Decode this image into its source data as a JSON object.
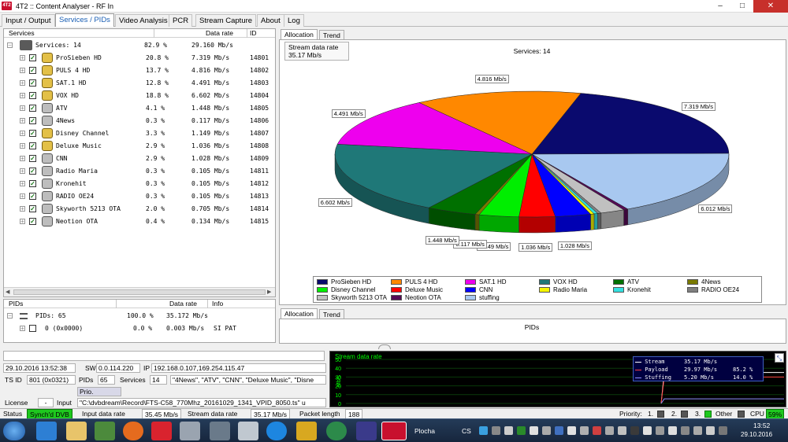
{
  "window": {
    "title": "4T2 :: Content Analyser - RF In",
    "logo_text": "4T2",
    "min": "–",
    "max": "□",
    "close": "✕"
  },
  "tabs": [
    "Input / Output",
    "Services / PIDs",
    "Video Analysis",
    "PCR",
    "Stream Capture",
    "About",
    "Log"
  ],
  "services_header": {
    "col1": "Services",
    "col2": "Data rate",
    "col3": "ID"
  },
  "services_root": {
    "label": "Services: 14",
    "pct": "82.9 %",
    "rate": "29.160 Mb/s"
  },
  "services": [
    {
      "name": "ProSieben HD",
      "pct": "20.8 %",
      "rate": "7.319 Mb/s",
      "id": "14801",
      "lock": true
    },
    {
      "name": "PULS 4 HD",
      "pct": "13.7 %",
      "rate": "4.816 Mb/s",
      "id": "14802",
      "lock": true
    },
    {
      "name": "SAT.1 HD",
      "pct": "12.8 %",
      "rate": "4.491 Mb/s",
      "id": "14803",
      "lock": true
    },
    {
      "name": "VOX HD",
      "pct": "18.8 %",
      "rate": "6.602 Mb/s",
      "id": "14804",
      "lock": true
    },
    {
      "name": "ATV",
      "pct": "4.1 %",
      "rate": "1.448 Mb/s",
      "id": "14805",
      "lock": false
    },
    {
      "name": "4News",
      "pct": "0.3 %",
      "rate": "0.117 Mb/s",
      "id": "14806",
      "lock": false
    },
    {
      "name": "Disney Channel",
      "pct": "3.3 %",
      "rate": "1.149 Mb/s",
      "id": "14807",
      "lock": true
    },
    {
      "name": "Deluxe Music",
      "pct": "2.9 %",
      "rate": "1.036 Mb/s",
      "id": "14808",
      "lock": true
    },
    {
      "name": "CNN",
      "pct": "2.9 %",
      "rate": "1.028 Mb/s",
      "id": "14809",
      "lock": false
    },
    {
      "name": "Radio Maria",
      "pct": "0.3 %",
      "rate": "0.105 Mb/s",
      "id": "14811",
      "lock": false
    },
    {
      "name": "Kronehit",
      "pct": "0.3 %",
      "rate": "0.105 Mb/s",
      "id": "14812",
      "lock": false
    },
    {
      "name": "RADIO OE24",
      "pct": "0.3 %",
      "rate": "0.105 Mb/s",
      "id": "14813",
      "lock": false
    },
    {
      "name": "Skyworth 5213 OTA",
      "pct": "2.0 %",
      "rate": "0.705 Mb/s",
      "id": "14814",
      "lock": false
    },
    {
      "name": "Neotion OTA",
      "pct": "0.4 %",
      "rate": "0.134 Mb/s",
      "id": "14815",
      "lock": false
    }
  ],
  "pids_header": {
    "col1": "PIDs",
    "col2": "Data rate",
    "col3": "Info"
  },
  "pids_root": {
    "label": "PIDs: 65",
    "pct": "100.0 %",
    "rate": "35.172 Mb/s"
  },
  "pid_rows": [
    {
      "label": "0 (0x0000)",
      "pct": "0.0 %",
      "rate": "0.003 Mb/s",
      "info": "SI PAT"
    }
  ],
  "right_tabs": [
    "Allocation",
    "Trend"
  ],
  "stream_rate_box": {
    "label": "Stream data rate",
    "value": "35.17 Mb/s"
  },
  "chart_data": {
    "type": "pie",
    "title": "Services: 14",
    "unit": "Mb/s",
    "slices": [
      {
        "name": "ProSieben HD",
        "value": 7.319,
        "label": "7.319 Mb/s",
        "color": "#0a0a6e"
      },
      {
        "name": "stuffing",
        "value": 6.012,
        "label": "6.012 Mb/s",
        "color": "#a8c8f0"
      },
      {
        "name": "Neotion OTA",
        "value": 0.134,
        "label": "",
        "color": "#550a55"
      },
      {
        "name": "Skyworth 5213 OTA",
        "value": 0.705,
        "label": "",
        "color": "#c0c0c0"
      },
      {
        "name": "RADIO OE24",
        "value": 0.105,
        "label": "",
        "color": "#808080"
      },
      {
        "name": "Kronehit",
        "value": 0.105,
        "label": "",
        "color": "#33e0e0"
      },
      {
        "name": "Radio Maria",
        "value": 0.105,
        "label": "",
        "color": "#f5f500"
      },
      {
        "name": "CNN",
        "value": 1.028,
        "label": "1.028 Mb/s",
        "color": "#0000ff"
      },
      {
        "name": "Deluxe Music",
        "value": 1.036,
        "label": "1.036 Mb/s",
        "color": "#ff0000"
      },
      {
        "name": "Disney Channel",
        "value": 1.149,
        "label": "1.149 Mb/s",
        "color": "#00ee00"
      },
      {
        "name": "4News",
        "value": 0.117,
        "label": "0.117 Mb/s",
        "color": "#7a7a00"
      },
      {
        "name": "ATV",
        "value": 1.448,
        "label": "1.448 Mb/s",
        "color": "#007000"
      },
      {
        "name": "VOX HD",
        "value": 6.602,
        "label": "6.602 Mb/s",
        "color": "#1f7878"
      },
      {
        "name": "SAT.1 HD",
        "value": 4.491,
        "label": "4.491 Mb/s",
        "color": "#ee00ee"
      },
      {
        "name": "PULS 4 HD",
        "value": 4.816,
        "label": "4.816 Mb/s",
        "color": "#ff8800"
      }
    ],
    "legend": [
      {
        "name": "ProSieben HD",
        "color": "#0a0a6e"
      },
      {
        "name": "PULS 4 HD",
        "color": "#ff8800"
      },
      {
        "name": "SAT.1 HD",
        "color": "#ee00ee"
      },
      {
        "name": "VOX HD",
        "color": "#1f7878"
      },
      {
        "name": "ATV",
        "color": "#007000"
      },
      {
        "name": "4News",
        "color": "#7a7a00"
      },
      {
        "name": "Disney Channel",
        "color": "#00ee00"
      },
      {
        "name": "Deluxe Music",
        "color": "#ff0000"
      },
      {
        "name": "CNN",
        "color": "#0000ff"
      },
      {
        "name": "Radio Maria",
        "color": "#f5f500"
      },
      {
        "name": "Kronehit",
        "color": "#33e0e0"
      },
      {
        "name": "RADIO OE24",
        "color": "#808080"
      },
      {
        "name": "Skyworth 5213 OTA",
        "color": "#c0c0c0"
      },
      {
        "name": "Neotion OTA",
        "color": "#550a55"
      },
      {
        "name": "stuffing",
        "color": "#a8c8f0"
      }
    ],
    "legend_position": "bottom"
  },
  "pids_chart_title": "PIDs",
  "info": {
    "datetime": "29.10.2016 13:52:38",
    "sw_label": "SW",
    "sw": "0.0.114.220",
    "ip_label": "IP",
    "ip": "192.168.0.107,169.254.115.47",
    "tsid_label": "TS ID",
    "tsid": "801 (0x0321)",
    "pids_label": "PIDs",
    "pids": "65",
    "services_label": "Services",
    "services": "14",
    "services_list": "\"4News\", \"ATV\", \"CNN\", \"Deluxe Music\", \"Disne",
    "prio_label": "Prio.",
    "license_label": "License",
    "license": "-",
    "input_label": "Input",
    "input": "\"C:\\dvbdream\\Record\\FTS-C58_770Mhz_20161029_1341_VPID_8050.ts\" u"
  },
  "trend": {
    "title": "Stream data rate",
    "ylabel": "Mb/s",
    "yticks": [
      "50",
      "40",
      "30",
      "20",
      "10",
      "0"
    ],
    "legend": [
      {
        "name": "Stream",
        "value": "35.17 Mb/s",
        "pct": "",
        "color": "#ffffff"
      },
      {
        "name": "Payload",
        "value": "29.97 Mb/s",
        "pct": "85.2 %",
        "color": "#ff4040"
      },
      {
        "name": "Stuffing",
        "value": "5.20 Mb/s",
        "pct": "14.0 %",
        "color": "#9090ff"
      }
    ]
  },
  "status": {
    "status_label": "Status",
    "status_value": "Synch'd DVB",
    "input_rate_label": "Input data rate",
    "input_rate": "35.45 Mb/s",
    "stream_rate_label": "Stream data rate",
    "stream_rate": "35.17 Mb/s",
    "packet_label": "Packet length",
    "packet": "188",
    "priority_label": "Priority:",
    "p1": "1.",
    "p2": "2.",
    "p3": "3.",
    "other_label": "Other",
    "cpu_label": "CPU",
    "cpu": "59%"
  },
  "taskbar": {
    "plocha": "Plocha",
    "lang": "CS",
    "time": "13:52",
    "date": "29.10.2016"
  }
}
